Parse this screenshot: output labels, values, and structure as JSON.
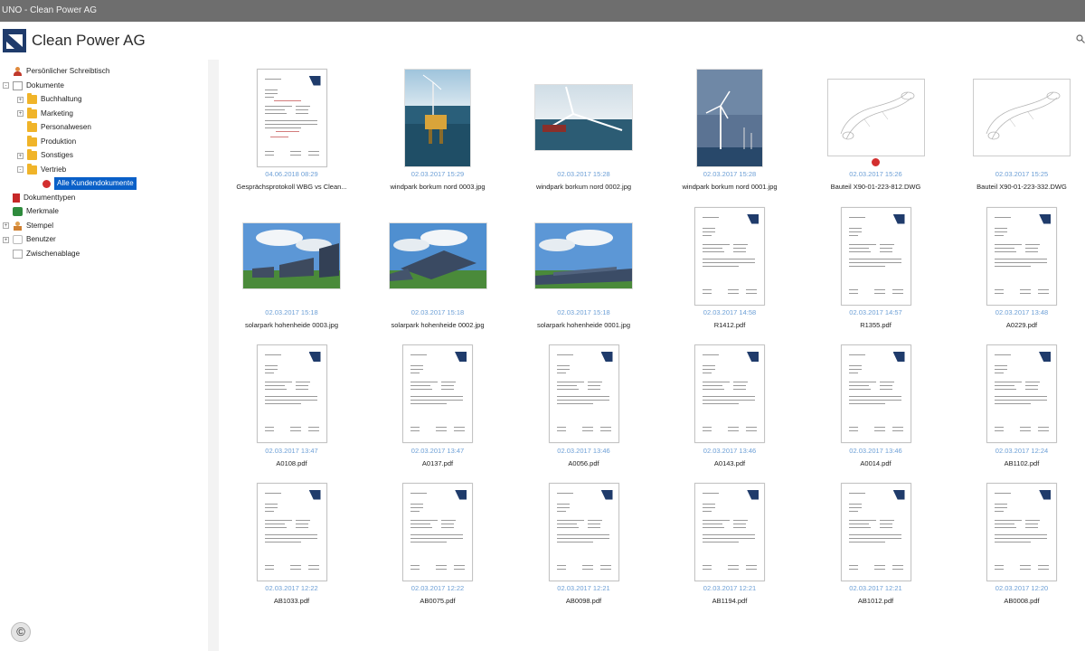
{
  "window": {
    "title": "UNO - Clean Power AG"
  },
  "header": {
    "app_title": "Clean Power AG",
    "search_icon": "search-icon"
  },
  "sidebar": {
    "items": [
      {
        "label": "Persönlicher Schreibtisch",
        "icon": "person-icon",
        "level": 0
      },
      {
        "label": "Dokumente",
        "icon": "documents-icon",
        "level": 0
      },
      {
        "label": "Buchhaltung",
        "icon": "folder-icon",
        "level": 1
      },
      {
        "label": "Marketing",
        "icon": "folder-icon",
        "level": 1
      },
      {
        "label": "Personalwesen",
        "icon": "folder-icon",
        "level": 1
      },
      {
        "label": "Produktion",
        "icon": "folder-icon",
        "level": 1
      },
      {
        "label": "Sonstiges",
        "icon": "folder-icon",
        "level": 1
      },
      {
        "label": "Vertrieb",
        "icon": "folder-icon",
        "level": 1
      },
      {
        "label": "Alle Kundendokumente",
        "icon": "alert-icon",
        "level": 2,
        "selected": true
      },
      {
        "label": "Dokumenttypen",
        "icon": "bookmark-icon",
        "level": 0
      },
      {
        "label": "Merkmale",
        "icon": "tag-icon",
        "level": 0
      },
      {
        "label": "Stempel",
        "icon": "stamp-icon",
        "level": 0
      },
      {
        "label": "Benutzer",
        "icon": "user-icon",
        "level": 0
      },
      {
        "label": "Zwischenablage",
        "icon": "clipboard-icon",
        "level": 0
      }
    ]
  },
  "documents": [
    {
      "date": "04.06.2018 08:29",
      "name": "Gesprächsprotokoll WBG vs Clean...",
      "kind": "pdf"
    },
    {
      "date": "02.03.2017 15:29",
      "name": "windpark borkum nord 0003.jpg",
      "kind": "photo-wind-platform"
    },
    {
      "date": "02.03.2017 15:28",
      "name": "windpark borkum nord 0002.jpg",
      "kind": "photo-wind-turbine"
    },
    {
      "date": "02.03.2017 15:28",
      "name": "windpark borkum nord 0001.jpg",
      "kind": "photo-wind-farm"
    },
    {
      "date": "02.03.2017 15:26",
      "name": "Bauteil X90-01-223-812.DWG",
      "kind": "dwg",
      "badge": true
    },
    {
      "date": "02.03.2017 15:25",
      "name": "Bauteil X90-01-223-332.DWG",
      "kind": "dwg"
    },
    {
      "date": "02.03.2017 15:18",
      "name": "solarpark hohenheide 0003.jpg",
      "kind": "photo-solar-1"
    },
    {
      "date": "02.03.2017 15:18",
      "name": "solarpark hohenheide 0002.jpg",
      "kind": "photo-solar-2"
    },
    {
      "date": "02.03.2017 15:18",
      "name": "solarpark hohenheide 0001.jpg",
      "kind": "photo-solar-3"
    },
    {
      "date": "02.03.2017 14:58",
      "name": "R1412.pdf",
      "kind": "pdf"
    },
    {
      "date": "02.03.2017 14:57",
      "name": "R1355.pdf",
      "kind": "pdf"
    },
    {
      "date": "02.03.2017 13:48",
      "name": "A0229.pdf",
      "kind": "pdf"
    },
    {
      "date": "02.03.2017 13:47",
      "name": "A0108.pdf",
      "kind": "pdf"
    },
    {
      "date": "02.03.2017 13:47",
      "name": "A0137.pdf",
      "kind": "pdf"
    },
    {
      "date": "02.03.2017 13:46",
      "name": "A0056.pdf",
      "kind": "pdf"
    },
    {
      "date": "02.03.2017 13:46",
      "name": "A0143.pdf",
      "kind": "pdf"
    },
    {
      "date": "02.03.2017 13:46",
      "name": "A0014.pdf",
      "kind": "pdf"
    },
    {
      "date": "02.03.2017 12:24",
      "name": "AB1102.pdf",
      "kind": "pdf"
    },
    {
      "date": "02.03.2017 12:22",
      "name": "AB1033.pdf",
      "kind": "pdf"
    },
    {
      "date": "02.03.2017 12:22",
      "name": "AB0075.pdf",
      "kind": "pdf"
    },
    {
      "date": "02.03.2017 12:21",
      "name": "AB0098.pdf",
      "kind": "pdf"
    },
    {
      "date": "02.03.2017 12:21",
      "name": "AB1194.pdf",
      "kind": "pdf"
    },
    {
      "date": "02.03.2017 12:21",
      "name": "AB1012.pdf",
      "kind": "pdf"
    },
    {
      "date": "02.03.2017 12:20",
      "name": "AB0008.pdf",
      "kind": "pdf"
    }
  ],
  "footer": {
    "copyright": "©"
  },
  "colors": {
    "selection": "#0a60c8",
    "date_text": "#6c9fd6",
    "folder": "#f0b429",
    "titlebar": "#6e6e6e"
  }
}
